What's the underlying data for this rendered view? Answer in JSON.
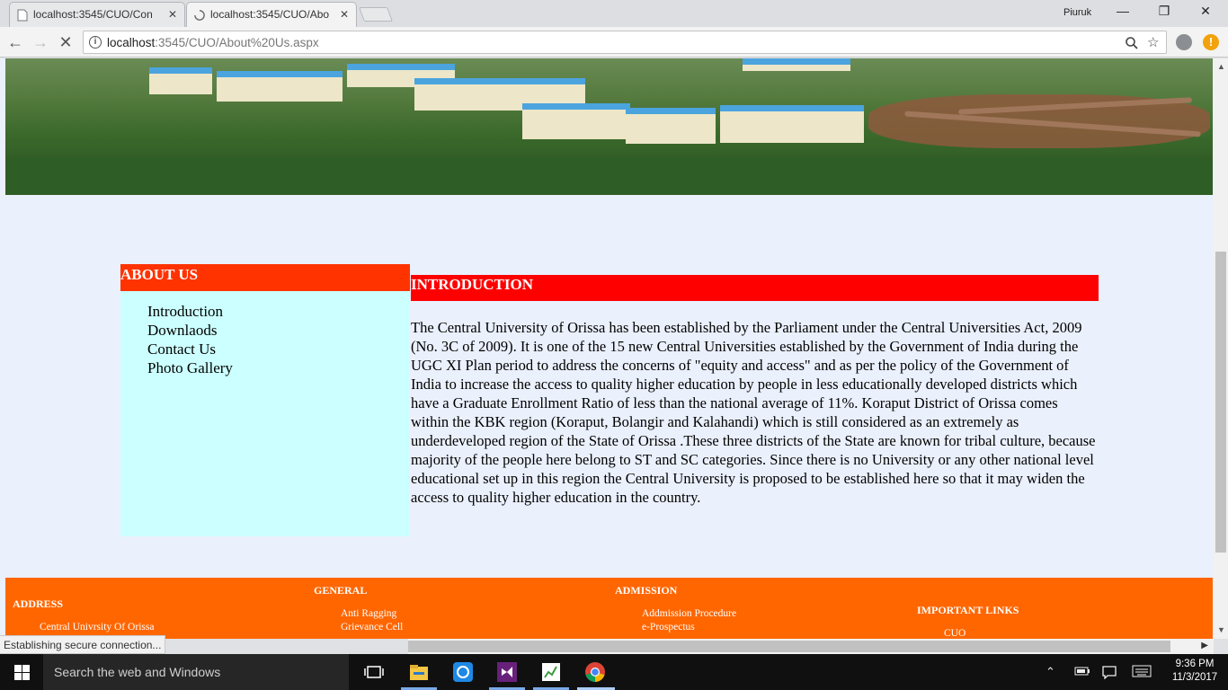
{
  "browser": {
    "tabs": [
      {
        "title": "localhost:3545/CUO/Con",
        "active": false
      },
      {
        "title": "localhost:3545/CUO/Abo",
        "active": true
      }
    ],
    "profile_name": "Piuruk",
    "url_host": "localhost",
    "url_path": ":3545/CUO/About%20Us.aspx",
    "status_text": "Establishing secure connection..."
  },
  "sidebar": {
    "heading": "ABOUT US",
    "items": [
      "Introduction",
      "Downlaods",
      "Contact Us",
      "Photo Gallery"
    ]
  },
  "main": {
    "heading": "INTRODUCTION",
    "body": "The Central University of Orissa has been established by the Parliament under the Central Universities Act, 2009 (No. 3C of 2009). It is one of the 15 new Central Universities established by the Government of India during the UGC XI Plan period to address the concerns of \"equity and access\" and as per the policy of the Government of India to increase the access to quality higher education by people in less educationally developed districts which have a Graduate Enrollment Ratio of less than the national average of 11%. Koraput District of Orissa comes within the KBK region (Koraput, Bolangir and Kalahandi) which is still considered as an extremely as underdeveloped region of the State of Orissa .These three districts of the State are known for tribal culture, because majority of the people here belong to ST and SC categories. Since there is no University or any other national level educational set up in this region the Central University is proposed to be established here so that it may widen the access to quality higher education in the country."
  },
  "footer": {
    "address": {
      "heading": "ADDRESS",
      "items": [
        "Central Univrsity Of Orissa"
      ]
    },
    "general": {
      "heading": "GENERAL",
      "items": [
        "Anti Ragging",
        "Grievance Cell"
      ]
    },
    "admission": {
      "heading": "ADMISSION",
      "items": [
        "Addmission Procedure",
        "e-Prospectus"
      ]
    },
    "important_links": {
      "heading": "IMPORTANT LINKS",
      "items": [
        "CUO"
      ]
    }
  },
  "taskbar": {
    "search_placeholder": "Search the web and Windows",
    "time": "9:36 PM",
    "date": "11/3/2017"
  },
  "colors": {
    "about_header": "#ff3300",
    "intro_header": "#ff0000",
    "sidebar_bg": "#ccffff",
    "page_bg": "#eaf0fc",
    "footer_bg": "#ff6600"
  }
}
